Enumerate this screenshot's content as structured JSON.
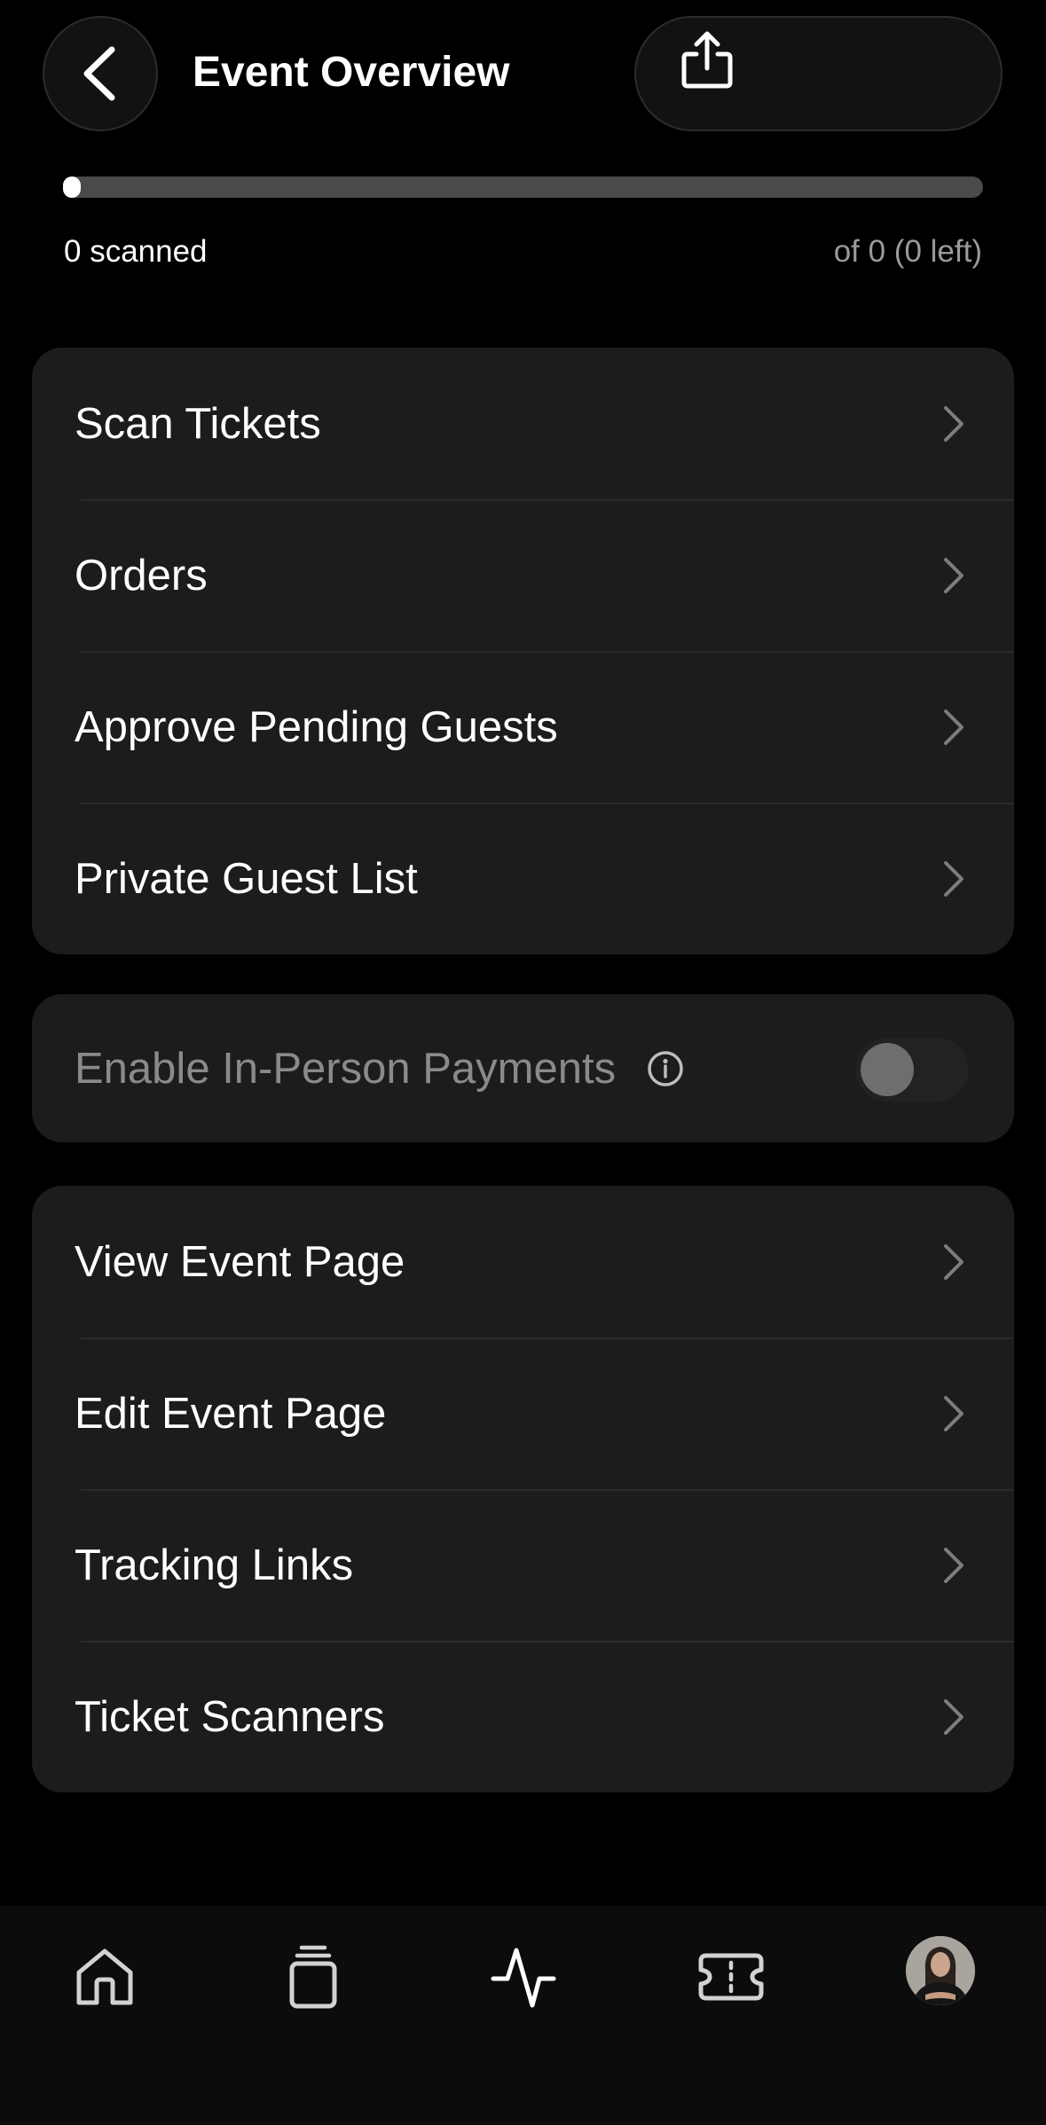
{
  "header": {
    "title": "Event Overview",
    "back_icon": "chevron-left-icon",
    "share_icon": "share-icon"
  },
  "scan_progress": {
    "scanned_text": "0 scanned",
    "remaining_text": "of 0 (0 left)",
    "fraction": 0
  },
  "menu_main": [
    {
      "label": "Scan Tickets"
    },
    {
      "label": "Orders"
    },
    {
      "label": "Approve Pending Guests"
    },
    {
      "label": "Private Guest List"
    }
  ],
  "payments": {
    "label": "Enable In-Person Payments",
    "info_icon": "info-icon",
    "enabled": false
  },
  "menu_page": [
    {
      "label": "View Event Page"
    },
    {
      "label": "Edit Event Page"
    },
    {
      "label": "Tracking Links"
    },
    {
      "label": "Ticket Scanners"
    }
  ],
  "bottom_nav": {
    "items": [
      "home-icon",
      "stack-icon",
      "activity-icon",
      "ticket-icon",
      "avatar"
    ]
  },
  "colors": {
    "background": "#000000",
    "card": "#1c1c1c",
    "muted_text": "#9a9a9a",
    "progress_track": "#4a4a4a"
  }
}
